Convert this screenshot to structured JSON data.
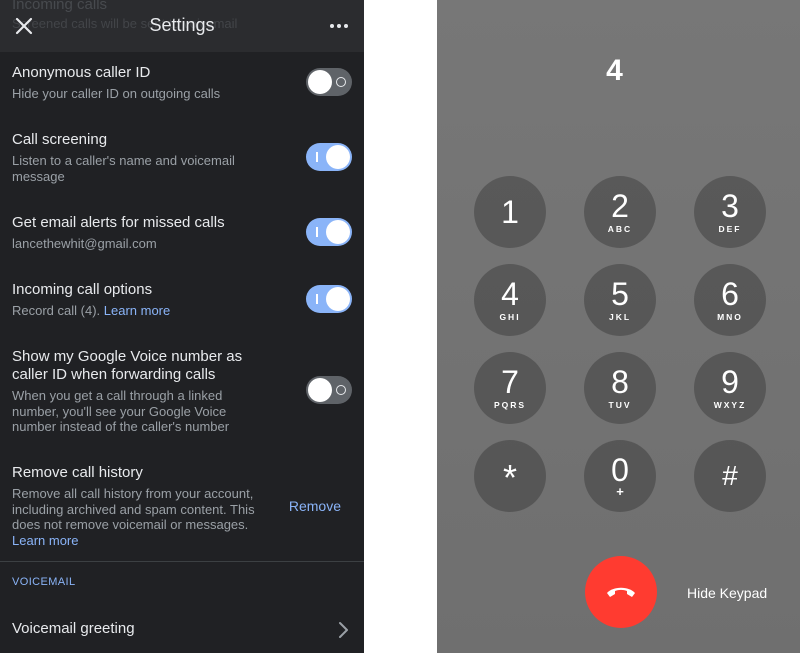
{
  "settings": {
    "title": "Settings",
    "behind_header": {
      "line1": "Incoming calls",
      "line2": "Screened calls will be sent to voicemail"
    },
    "items": [
      {
        "label": "Anonymous caller ID",
        "sub": "Hide your caller ID on outgoing calls",
        "state": "off"
      },
      {
        "label": "Call screening",
        "sub": "Listen to a caller's name and voicemail message",
        "state": "on"
      },
      {
        "label": "Get email alerts for missed calls",
        "sub": "lancethewhit@gmail.com",
        "state": "on"
      },
      {
        "label": "Incoming call options",
        "sub": "Record call (4).",
        "link": "Learn more",
        "state": "on"
      },
      {
        "label": "Show my Google Voice number as caller ID when forwarding calls",
        "sub": "When you get a call through a linked number, you'll see your Google Voice number instead of the caller's number",
        "state": "off"
      }
    ],
    "remove_history": {
      "label": "Remove call history",
      "sub": "Remove all call history from your account, including archived and spam content. This does not remove voicemail or messages.",
      "link": "Learn more",
      "button": "Remove"
    },
    "section_header": "VOICEMAIL",
    "voicemail_greeting": "Voicemail greeting"
  },
  "keypad": {
    "display": "4",
    "keys": [
      {
        "digit": "1",
        "letters": ""
      },
      {
        "digit": "2",
        "letters": "ABC"
      },
      {
        "digit": "3",
        "letters": "DEF"
      },
      {
        "digit": "4",
        "letters": "GHI"
      },
      {
        "digit": "5",
        "letters": "JKL"
      },
      {
        "digit": "6",
        "letters": "MNO"
      },
      {
        "digit": "7",
        "letters": "PQRS"
      },
      {
        "digit": "8",
        "letters": "TUV"
      },
      {
        "digit": "9",
        "letters": "WXYZ"
      },
      {
        "digit": "*",
        "letters": ""
      },
      {
        "digit": "0",
        "letters": "+"
      },
      {
        "digit": "#",
        "letters": ""
      }
    ],
    "hide_label": "Hide Keypad",
    "end_color": "#ff3b30"
  },
  "colors": {
    "accent": "#8ab4f8",
    "panel_bg": "#202124"
  }
}
